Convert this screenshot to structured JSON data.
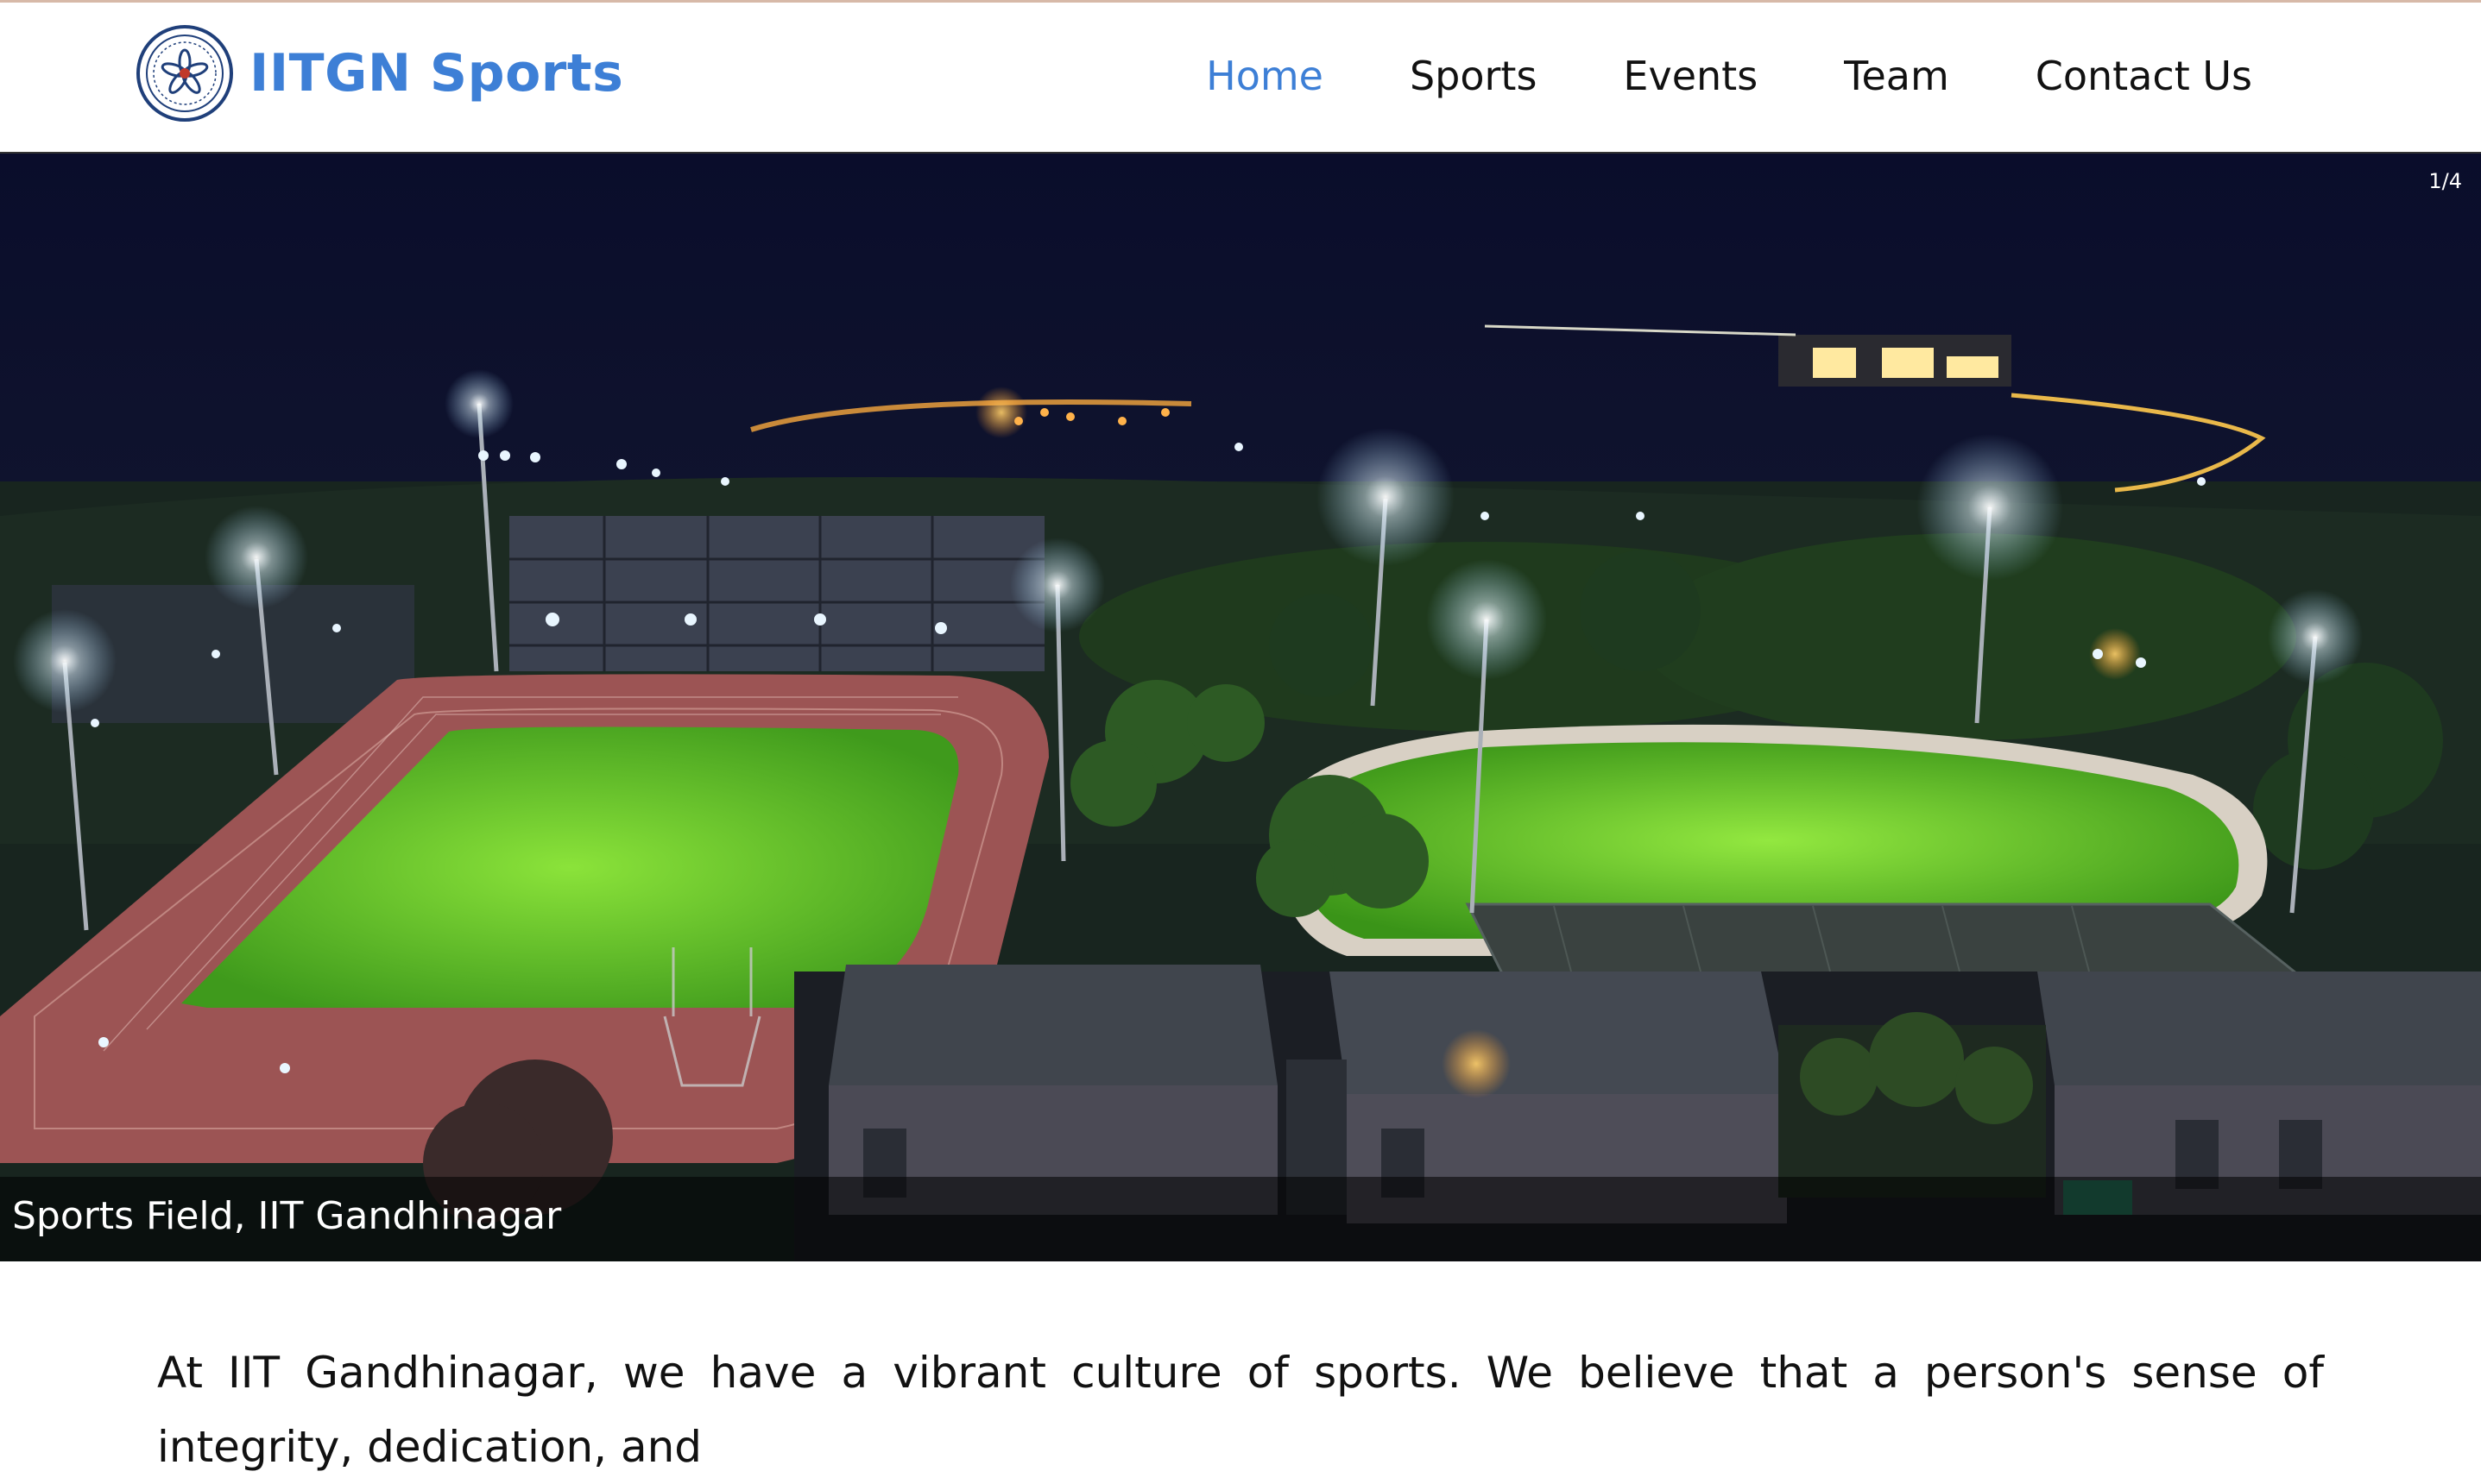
{
  "header": {
    "brand": "IITGN Sports",
    "logo_icon": "iitgn-emblem-icon",
    "nav": [
      {
        "label": "Home",
        "active": true
      },
      {
        "label": "Sports",
        "active": false
      },
      {
        "label": "Events",
        "active": false
      },
      {
        "label": "Team",
        "active": false
      },
      {
        "label": "Contact Us",
        "active": false
      }
    ]
  },
  "slideshow": {
    "counter": "1/4",
    "caption": "Sports Field, IIT Gandhinagar"
  },
  "intro": {
    "text": "At IIT Gandhinagar, we have a vibrant culture of sports. We believe that a person's sense of integrity, dedication, and"
  },
  "colors": {
    "accent": "#3d7fd6",
    "text": "#111111",
    "header_border": "#333333"
  }
}
